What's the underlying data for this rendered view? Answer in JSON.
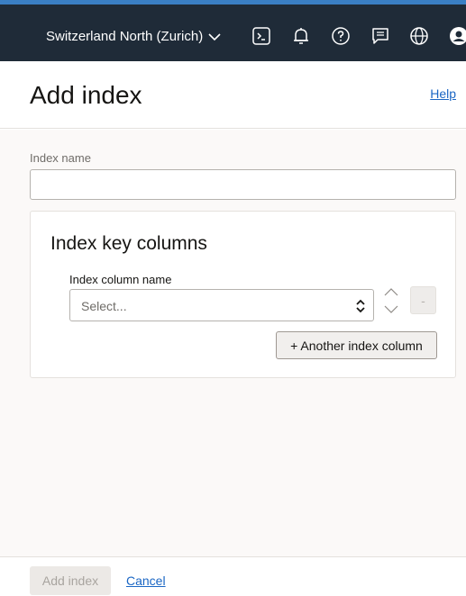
{
  "topbar": {
    "region_label": "Switzerland North (Zurich)",
    "icons": [
      "chevron-down-icon",
      "cloud-shell-icon",
      "bell-icon",
      "help-circle-icon",
      "feedback-icon",
      "globe-icon",
      "user-profile-icon"
    ],
    "background_color": "#1f2b38",
    "accent_color": "#3a7fc4"
  },
  "header": {
    "title": "Add index",
    "help_link": "Help"
  },
  "form": {
    "index_name_label": "Index name",
    "index_name_value": "",
    "key_columns": {
      "title": "Index key columns",
      "column_label": "Index column name",
      "select_placeholder": "Select...",
      "remove_label": "-",
      "add_column_label": "+ Another index column"
    }
  },
  "footer": {
    "submit_label": "Add index",
    "cancel_label": "Cancel"
  },
  "colors": {
    "link": "#1a66c4",
    "disabled_text": "#a8a49f"
  }
}
